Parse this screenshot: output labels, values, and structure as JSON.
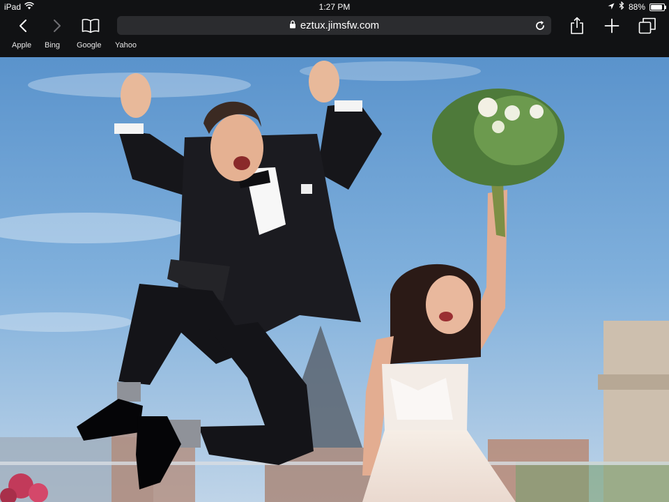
{
  "status_bar": {
    "device": "iPad",
    "time": "1:27 PM",
    "battery": "88%",
    "battery_level": 0.88,
    "icons": [
      "wifi-icon",
      "location-arrow-icon",
      "bluetooth-icon",
      "battery-icon"
    ]
  },
  "toolbar": {
    "url": "eztux.jimsfw.com",
    "icons": [
      "back-icon",
      "forward-icon",
      "bookmarks-book-icon",
      "lock-icon",
      "reload-icon",
      "share-icon",
      "new-tab-plus-icon",
      "tabs-icon"
    ]
  },
  "bookmarks": [
    {
      "label": "Apple"
    },
    {
      "label": "Bing"
    },
    {
      "label": "Google"
    },
    {
      "label": "Yahoo"
    }
  ],
  "content": {
    "image": "hero-photo-groom-jumping-bride-bouquet"
  },
  "colors": {
    "chrome_bg": "#111214",
    "urlbar_bg": "#2b2c2f",
    "sky": "#7aabd9",
    "tux": "#16161a"
  }
}
